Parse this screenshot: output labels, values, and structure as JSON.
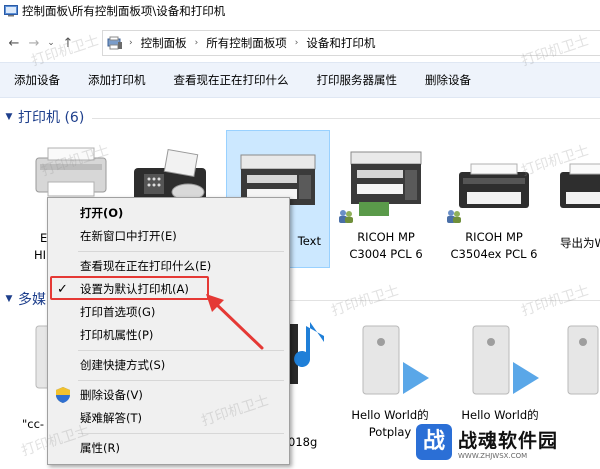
{
  "window": {
    "title": "控制面板\\所有控制面板项\\设备和打印机"
  },
  "nav": {
    "back": "←",
    "forward": "→",
    "dropdown": "⌄",
    "up": "↑"
  },
  "address": {
    "crumbs": [
      "控制面板",
      "所有控制面板项",
      "设备和打印机"
    ],
    "separator": "›"
  },
  "toolbar": {
    "items": [
      "添加设备",
      "添加打印机",
      "查看现在正在打印什么",
      "打印服务器属性",
      "删除设备"
    ]
  },
  "printers": {
    "header": "打印机 (6)",
    "items": [
      {
        "label1": "",
        "label2": ""
      },
      {
        "label1": "",
        "label2": ""
      },
      {
        "label1": "Text",
        "label2": ""
      },
      {
        "label1": "RICOH MP",
        "label2": "C3004 PCL 6"
      },
      {
        "label1": "RICOH MP",
        "label2": "C3504ex PCL 6"
      },
      {
        "label1": "导出为W",
        "label2": ""
      }
    ],
    "partial_left_1": "E",
    "partial_left_2": "HI"
  },
  "multimedia": {
    "header": "多媒",
    "items": [
      {
        "label1": "\"cc-",
        "label2": ""
      },
      {
        "label1": "",
        "label2": "018g"
      },
      {
        "label1": "Hello World的",
        "label2": "Potplay"
      },
      {
        "label1": "Hello World的",
        "label2": ""
      }
    ]
  },
  "context_menu": {
    "items": [
      {
        "label": "打开(O)",
        "bold": true,
        "check": false,
        "shield": false
      },
      {
        "label": "在新窗口中打开(E)",
        "bold": false,
        "check": false,
        "shield": false
      },
      {
        "label": "查看现在正在打印什么(E)",
        "bold": false,
        "check": false,
        "shield": false
      },
      {
        "label": "设置为默认打印机(A)",
        "bold": false,
        "check": true,
        "shield": false
      },
      {
        "label": "打印首选项(G)",
        "bold": false,
        "check": false,
        "shield": false
      },
      {
        "label": "打印机属性(P)",
        "bold": false,
        "check": false,
        "shield": false
      },
      {
        "label": "创建快捷方式(S)",
        "bold": false,
        "check": false,
        "shield": false
      },
      {
        "label": "删除设备(V)",
        "bold": false,
        "check": false,
        "shield": true
      },
      {
        "label": "疑难解答(T)",
        "bold": false,
        "check": false,
        "shield": false
      },
      {
        "label": "属性(R)",
        "bold": false,
        "check": false,
        "shield": false
      }
    ],
    "checkmark": "✓"
  },
  "watermark": {
    "text": "打印机卫士"
  },
  "brand": {
    "logo_char": "战",
    "name": "战魂软件园",
    "url": "WWW.ZHJWSX.COM"
  },
  "colors": {
    "accent_header": "#1e3f8c",
    "commandbar_bg": "#eef3fb",
    "selection_bg": "#cce8ff",
    "highlight_red": "#e53935"
  }
}
